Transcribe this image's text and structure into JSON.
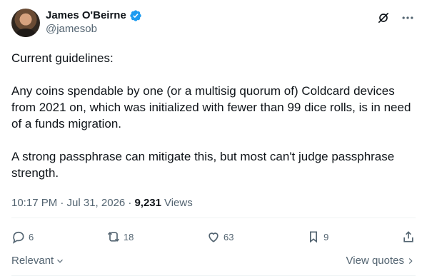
{
  "tweet": {
    "author": {
      "name": "James O'Beirne",
      "handle": "@jamesob"
    },
    "paragraphs": [
      "Current guidelines:",
      "Any coins spendable by one (or a multisig quorum of) Coldcard devices from 2021 on, which was initialized with fewer than 99 dice rolls, is in need of a funds migration.",
      "A strong passphrase can mitigate this, but most can't judge passphrase strength."
    ],
    "timestamp": "10:17 PM · Jul 31, 2026 ·",
    "views_count": "9,231",
    "views_label": "Views",
    "stats": {
      "replies": "6",
      "reposts": "18",
      "likes": "63",
      "bookmarks": "9"
    }
  },
  "footer": {
    "sort_label": "Relevant",
    "quotes_link": "View quotes"
  },
  "colors": {
    "text": "#0f1419",
    "muted": "#536471",
    "verified": "#1d9bf0",
    "divider": "#eff3f4"
  },
  "icons": {
    "grok": "grok-icon",
    "more": "more-icon",
    "reply": "reply-icon",
    "repost": "repost-icon",
    "like": "like-icon",
    "bookmark": "bookmark-icon",
    "share": "share-icon"
  }
}
